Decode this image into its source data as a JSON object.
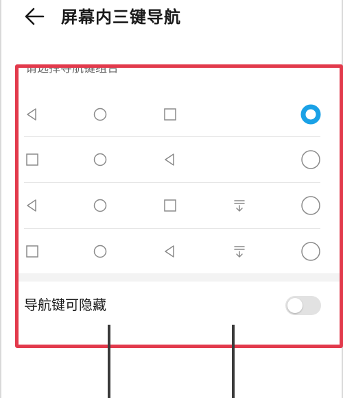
{
  "header": {
    "title": "屏幕内三键导航",
    "back_icon": "arrow-left-icon"
  },
  "nav_combo": {
    "section_label": "请选择导航键组合",
    "options": [
      {
        "keys": [
          "back-triangle-icon",
          "home-circle-icon",
          "recents-square-icon"
        ],
        "selected": true
      },
      {
        "keys": [
          "recents-square-icon",
          "home-circle-icon",
          "back-triangle-icon"
        ],
        "selected": false
      },
      {
        "keys": [
          "back-triangle-icon",
          "home-circle-icon",
          "recents-square-icon",
          "notification-pulldown-icon"
        ],
        "selected": false
      },
      {
        "keys": [
          "recents-square-icon",
          "home-circle-icon",
          "back-triangle-icon",
          "notification-pulldown-icon"
        ],
        "selected": false
      }
    ]
  },
  "hide_nav": {
    "label": "导航键可隐藏",
    "enabled": false
  },
  "colors": {
    "accent": "#1aa1e6",
    "highlight_border": "#e23a4c",
    "icon_gray": "#8a8a8a"
  }
}
